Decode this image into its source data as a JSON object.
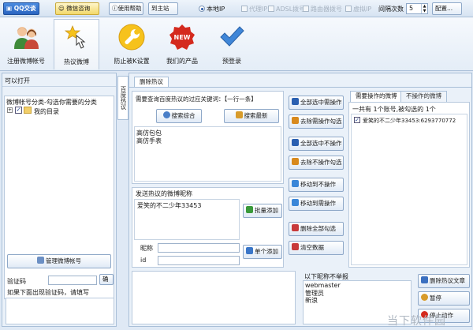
{
  "topbar": {
    "qq_button": "QQ交谈",
    "wechat_button": "微信咨询",
    "help_button": "使用帮助",
    "site_button": "到主站",
    "ip_options": [
      "本地IP",
      "代理IP",
      "ADSL拨号",
      "路由器拨号",
      "虚拟IP"
    ],
    "refresh_label": "间隔次数",
    "refresh_value": "5",
    "config_button": "配置..."
  },
  "toolbar": {
    "tools": [
      "注册微博帐号",
      "热议微博",
      "防止被K设置",
      "我们的产品",
      "预登录"
    ]
  },
  "left": {
    "open_label": "可以打开",
    "tree_header": "微博帐号分类-勾选你需要的分类",
    "tree_root": "我的目录",
    "manage_button": "管理微博帐号",
    "captcha_label": "验证码",
    "captcha_button": "确",
    "captcha_hint": "如果下面出现验证码，请填写"
  },
  "vertical_tab": "百度热议",
  "main": {
    "subtab": "删除热议",
    "keyword_title": "需要查询百度热议的过应关键词：【一行一条】",
    "search_all_button": "搜索综合",
    "search_new_button": "搜索最新",
    "keywords": [
      "高仿包包",
      "高仿手表"
    ],
    "send_title": "发送热议的微博昵称",
    "send_entry": "爱笑的不二少年33453",
    "batch_add_button": "批量添加",
    "nickname_label": "昵称",
    "id_label": "id",
    "single_add_button": "单个添加",
    "mid_buttons": [
      "全部选中需操作",
      "去除需操作勾选",
      "全部选中不操作",
      "去除不操作勾选",
      "移动到不操作",
      "移动到需操作",
      "删除全部勾选",
      "清空数据"
    ],
    "right_tabs": [
      "需要操作的微博",
      "不操作的微博"
    ],
    "count_text": "一共有 1个账号,被勾选的 1个",
    "account_entry": "爱笑的不二少年33453:6293770772",
    "exclude_title": "以下昵称不举报",
    "exclude_list": [
      "webmaster",
      "管理员",
      "新浪"
    ],
    "delete_button": "删除热议文章",
    "pause_button": "暂停",
    "stop_button": "停止动作"
  },
  "watermark": "当下软件园"
}
